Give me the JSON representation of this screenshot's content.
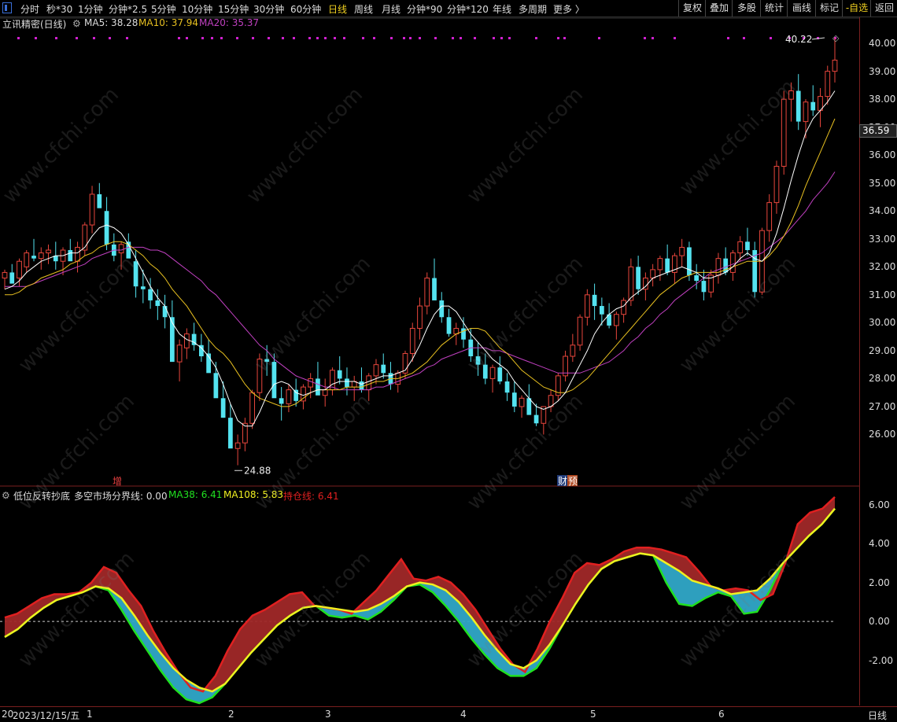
{
  "toolbar": {
    "periods": [
      "分时",
      "秒*30",
      "1分钟",
      "分钟*2.5",
      "5分钟",
      "10分钟",
      "15分钟",
      "30分钟",
      "60分钟",
      "日线",
      "周线",
      "月线",
      "分钟*90",
      "分钟*120",
      "年线",
      "多周期",
      "更多 〉"
    ],
    "active_index": 9,
    "right_buttons": [
      "复权",
      "叠加",
      "多股",
      "统计",
      "画线",
      "标记",
      "-自选",
      "返回"
    ]
  },
  "title": {
    "stock": "立讯精密(日线)",
    "ma5": "MA5: 38.28",
    "ma10": "MA10: 37.94",
    "ma20": "MA20: 35.37"
  },
  "indicator": {
    "name": "低位反转抄底",
    "boundary": "多空市场分界线: 0.00",
    "ma38": "MA38: 6.41",
    "ma108": "MA108: 5.83",
    "hold": "持仓线: 6.41"
  },
  "annotations": {
    "high": "40.22",
    "low": "24.88",
    "current_price": "36.59",
    "event_zeng": "增",
    "event_cai": "财",
    "event_yu": "预"
  },
  "axis": {
    "price_ticks": [
      "40.00",
      "39.00",
      "38.00",
      "37.00",
      "36.00",
      "35.00",
      "34.00",
      "33.00",
      "32.00",
      "31.00",
      "30.00",
      "29.00",
      "28.00",
      "27.00",
      "26.00"
    ],
    "ind_ticks": [
      "6.00",
      "4.00",
      "2.00",
      "0.00",
      "-2.00"
    ],
    "date_label": "2023/12/15/五",
    "date_prefix": "20",
    "months": [
      "1",
      "2",
      "3",
      "4",
      "5",
      "6"
    ],
    "period_label": "日线"
  },
  "watermark": "www.cfchi.com",
  "colors": {
    "up": "#e8463c",
    "down": "#54e3f0",
    "ma5": "#ffffff",
    "ma10": "#e8c020",
    "ma20": "#c040c0",
    "ind_red": "#e02020",
    "ind_yellow": "#f0f020",
    "ind_green": "#20e020",
    "ind_fill_red": "#a02828",
    "ind_fill_cyan": "#30a8c8"
  },
  "chart_data": {
    "type": "candlestick",
    "y_range": [
      25.0,
      40.2
    ],
    "candles": [
      [
        31.6,
        31.9,
        31.2,
        31.8
      ],
      [
        31.8,
        32.1,
        31.5,
        31.4
      ],
      [
        31.6,
        32.3,
        31.3,
        32.2
      ],
      [
        32.0,
        32.6,
        31.8,
        32.5
      ],
      [
        32.4,
        33.0,
        32.2,
        32.3
      ],
      [
        32.3,
        32.7,
        31.9,
        32.5
      ],
      [
        32.5,
        32.8,
        32.1,
        32.6
      ],
      [
        32.4,
        32.9,
        31.9,
        32.2
      ],
      [
        32.2,
        32.7,
        31.7,
        32.6
      ],
      [
        32.6,
        33.0,
        32.3,
        32.2
      ],
      [
        32.2,
        32.9,
        31.8,
        32.7
      ],
      [
        32.6,
        33.6,
        32.4,
        33.5
      ],
      [
        33.5,
        34.9,
        33.2,
        34.6
      ],
      [
        34.6,
        35.0,
        34.2,
        34.1
      ],
      [
        34.0,
        34.5,
        32.6,
        32.8
      ],
      [
        32.8,
        33.2,
        32.2,
        32.4
      ],
      [
        32.5,
        32.9,
        31.9,
        32.8
      ],
      [
        32.9,
        33.2,
        32.5,
        32.3
      ],
      [
        32.2,
        32.6,
        30.9,
        31.3
      ],
      [
        31.3,
        31.9,
        30.7,
        31.2
      ],
      [
        31.2,
        31.6,
        30.5,
        30.8
      ],
      [
        30.8,
        31.2,
        30.1,
        30.6
      ],
      [
        30.6,
        31.0,
        29.8,
        30.2
      ],
      [
        30.2,
        30.8,
        29.2,
        28.6
      ],
      [
        28.6,
        29.4,
        27.9,
        29.2
      ],
      [
        29.1,
        29.8,
        28.7,
        29.6
      ],
      [
        29.6,
        30.0,
        29.0,
        29.2
      ],
      [
        29.2,
        29.6,
        28.6,
        28.8
      ],
      [
        28.9,
        29.4,
        28.3,
        28.2
      ],
      [
        28.2,
        28.6,
        27.4,
        27.3
      ],
      [
        27.3,
        27.9,
        26.6,
        26.6
      ],
      [
        26.6,
        27.1,
        25.6,
        25.5
      ],
      [
        25.5,
        26.0,
        24.9,
        25.7
      ],
      [
        25.7,
        26.6,
        25.4,
        26.4
      ],
      [
        26.4,
        27.6,
        26.2,
        27.5
      ],
      [
        27.5,
        28.9,
        27.2,
        28.7
      ],
      [
        28.7,
        29.2,
        28.1,
        28.6
      ],
      [
        28.6,
        28.9,
        27.9,
        27.3
      ],
      [
        27.3,
        27.7,
        26.5,
        27.1
      ],
      [
        27.1,
        27.8,
        26.8,
        27.6
      ],
      [
        27.6,
        28.0,
        27.0,
        27.2
      ],
      [
        27.2,
        27.8,
        26.9,
        27.7
      ],
      [
        27.7,
        28.2,
        27.3,
        28.0
      ],
      [
        28.0,
        28.6,
        27.5,
        27.4
      ],
      [
        27.4,
        28.0,
        27.0,
        27.6
      ],
      [
        27.6,
        28.4,
        27.4,
        28.3
      ],
      [
        28.3,
        28.8,
        27.8,
        28.0
      ],
      [
        28.0,
        28.4,
        27.4,
        27.7
      ],
      [
        27.7,
        28.1,
        27.2,
        27.9
      ],
      [
        27.9,
        28.4,
        27.5,
        27.6
      ],
      [
        27.6,
        28.2,
        27.2,
        28.1
      ],
      [
        28.1,
        28.7,
        27.8,
        28.5
      ],
      [
        28.5,
        28.9,
        28.0,
        28.2
      ],
      [
        28.2,
        28.6,
        27.6,
        27.8
      ],
      [
        27.8,
        28.3,
        27.5,
        28.2
      ],
      [
        28.2,
        29.0,
        28.0,
        28.9
      ],
      [
        28.9,
        30.0,
        28.6,
        29.8
      ],
      [
        29.8,
        30.9,
        29.4,
        30.6
      ],
      [
        30.6,
        31.8,
        30.3,
        31.6
      ],
      [
        31.6,
        32.3,
        31.0,
        30.8
      ],
      [
        30.8,
        31.1,
        30.0,
        30.2
      ],
      [
        30.2,
        30.5,
        29.5,
        29.6
      ],
      [
        29.6,
        30.0,
        29.2,
        29.8
      ],
      [
        29.8,
        30.2,
        29.1,
        29.4
      ],
      [
        29.4,
        29.8,
        28.6,
        28.8
      ],
      [
        28.8,
        29.3,
        28.1,
        28.5
      ],
      [
        28.5,
        28.9,
        27.8,
        28.0
      ],
      [
        28.0,
        28.5,
        27.5,
        28.4
      ],
      [
        28.4,
        28.8,
        27.8,
        27.9
      ],
      [
        27.9,
        28.2,
        27.2,
        27.5
      ],
      [
        27.5,
        27.9,
        26.8,
        27.0
      ],
      [
        27.0,
        27.4,
        26.6,
        27.3
      ],
      [
        27.3,
        27.8,
        27.0,
        26.7
      ],
      [
        26.7,
        27.1,
        26.3,
        26.4
      ],
      [
        26.4,
        26.8,
        26.0,
        27.0
      ],
      [
        27.0,
        27.6,
        26.8,
        27.4
      ],
      [
        27.4,
        28.2,
        27.2,
        28.1
      ],
      [
        28.1,
        29.0,
        27.9,
        28.8
      ],
      [
        28.8,
        29.6,
        28.6,
        29.2
      ],
      [
        29.2,
        30.3,
        29.0,
        30.2
      ],
      [
        30.2,
        31.2,
        29.9,
        31.0
      ],
      [
        31.0,
        31.4,
        30.1,
        30.6
      ],
      [
        30.6,
        30.9,
        29.9,
        30.3
      ],
      [
        30.3,
        30.7,
        29.8,
        29.9
      ],
      [
        29.9,
        30.4,
        29.4,
        30.3
      ],
      [
        30.3,
        30.9,
        30.0,
        30.8
      ],
      [
        30.8,
        32.3,
        30.6,
        32.0
      ],
      [
        32.0,
        32.4,
        31.0,
        31.2
      ],
      [
        31.2,
        31.8,
        30.8,
        31.6
      ],
      [
        31.6,
        32.1,
        31.3,
        31.9
      ],
      [
        31.9,
        32.4,
        31.5,
        32.3
      ],
      [
        32.3,
        32.8,
        31.7,
        31.8
      ],
      [
        31.8,
        32.5,
        31.4,
        32.4
      ],
      [
        32.4,
        33.0,
        32.0,
        32.7
      ],
      [
        32.7,
        32.9,
        31.5,
        31.7
      ],
      [
        31.7,
        32.1,
        31.2,
        31.5
      ],
      [
        31.5,
        31.9,
        30.8,
        31.1
      ],
      [
        31.1,
        31.9,
        30.9,
        31.7
      ],
      [
        31.7,
        32.5,
        31.4,
        32.3
      ],
      [
        32.3,
        32.7,
        31.7,
        31.8
      ],
      [
        31.8,
        32.6,
        31.5,
        32.5
      ],
      [
        32.5,
        33.1,
        32.2,
        32.9
      ],
      [
        32.9,
        33.4,
        32.4,
        32.6
      ],
      [
        32.6,
        32.9,
        30.9,
        31.1
      ],
      [
        31.1,
        33.4,
        31.0,
        33.3
      ],
      [
        33.3,
        34.6,
        32.9,
        34.3
      ],
      [
        34.3,
        35.8,
        33.9,
        35.6
      ],
      [
        35.6,
        38.3,
        35.3,
        38.0
      ],
      [
        38.0,
        38.6,
        37.2,
        38.3
      ],
      [
        38.3,
        38.9,
        36.9,
        37.2
      ],
      [
        37.2,
        38.0,
        36.6,
        37.9
      ],
      [
        37.9,
        38.5,
        37.4,
        37.6
      ],
      [
        37.6,
        38.4,
        37.0,
        38.1
      ],
      [
        38.1,
        39.2,
        37.8,
        39.0
      ],
      [
        39.0,
        40.2,
        38.6,
        39.4
      ]
    ],
    "ma5": [
      31.2,
      31.3,
      31.5,
      31.8,
      32.0,
      32.2,
      32.3,
      32.4,
      32.4,
      32.5,
      32.5,
      32.7,
      33.1,
      33.4,
      33.5,
      33.4,
      33.2,
      32.8,
      32.3,
      31.8,
      31.3,
      30.9,
      30.6,
      30.0,
      29.6,
      29.4,
      29.3,
      29.1,
      28.8,
      28.4,
      27.8,
      27.1,
      26.5,
      26.3,
      26.3,
      26.8,
      27.4,
      27.8,
      27.9,
      27.8,
      27.5,
      27.4,
      27.5,
      27.6,
      27.6,
      27.8,
      27.9,
      27.9,
      27.9,
      27.8,
      27.9,
      28.0,
      28.1,
      28.1,
      28.2,
      28.3,
      28.7,
      29.2,
      29.8,
      30.3,
      30.6,
      30.6,
      30.4,
      30.0,
      29.6,
      29.3,
      29.0,
      28.7,
      28.5,
      28.3,
      27.9,
      27.6,
      27.3,
      27.0,
      26.9,
      27.0,
      27.2,
      27.5,
      28.0,
      28.5,
      29.0,
      29.6,
      30.0,
      30.3,
      30.5,
      30.6,
      30.9,
      31.1,
      31.3,
      31.6,
      31.7,
      31.8,
      31.9,
      32.0,
      31.9,
      31.8,
      31.6,
      31.6,
      31.7,
      31.8,
      32.0,
      32.3,
      32.5,
      32.3,
      32.2,
      32.5,
      33.2,
      34.1,
      35.1,
      36.0,
      36.8,
      37.3,
      37.6,
      37.9,
      38.3
    ],
    "ma10": [
      31.0,
      31.0,
      31.1,
      31.3,
      31.4,
      31.6,
      31.7,
      31.8,
      31.9,
      32.1,
      32.2,
      32.4,
      32.5,
      32.7,
      32.8,
      32.9,
      32.9,
      32.8,
      32.6,
      32.4,
      32.1,
      31.9,
      31.6,
      31.2,
      30.9,
      30.6,
      30.2,
      29.8,
      29.4,
      29.1,
      28.9,
      28.6,
      28.2,
      27.8,
      27.5,
      27.3,
      27.2,
      27.1,
      27.0,
      27.0,
      27.1,
      27.3,
      27.5,
      27.6,
      27.6,
      27.6,
      27.6,
      27.7,
      27.7,
      27.7,
      27.8,
      27.9,
      27.9,
      28.0,
      28.0,
      28.1,
      28.2,
      28.4,
      28.6,
      28.9,
      29.2,
      29.4,
      29.6,
      29.7,
      29.8,
      29.8,
      29.7,
      29.4,
      29.1,
      28.9,
      28.6,
      28.3,
      28.1,
      27.9,
      27.7,
      27.6,
      27.5,
      27.5,
      27.6,
      27.8,
      28.0,
      28.3,
      28.6,
      28.9,
      29.2,
      29.5,
      29.8,
      30.1,
      30.4,
      30.7,
      31.0,
      31.2,
      31.4,
      31.6,
      31.7,
      31.8,
      31.8,
      31.8,
      31.8,
      31.9,
      32.0,
      32.1,
      32.2,
      32.2,
      32.2,
      32.4,
      32.7,
      33.1,
      33.6,
      34.2,
      34.9,
      35.5,
      36.1,
      36.7,
      37.3
    ],
    "ma20": [
      31.3,
      31.3,
      31.3,
      31.3,
      31.4,
      31.5,
      31.6,
      31.7,
      31.8,
      31.9,
      32.0,
      32.1,
      32.3,
      32.4,
      32.5,
      32.6,
      32.6,
      32.7,
      32.7,
      32.7,
      32.6,
      32.6,
      32.5,
      32.3,
      32.1,
      31.9,
      31.7,
      31.5,
      31.2,
      31.0,
      30.7,
      30.4,
      30.1,
      29.8,
      29.5,
      29.2,
      29.0,
      28.7,
      28.5,
      28.3,
      28.1,
      28.0,
      27.9,
      27.8,
      27.7,
      27.7,
      27.6,
      27.6,
      27.6,
      27.6,
      27.6,
      27.7,
      27.7,
      27.8,
      27.9,
      28.0,
      28.1,
      28.2,
      28.4,
      28.5,
      28.7,
      28.8,
      28.9,
      29.0,
      29.1,
      29.1,
      29.1,
      29.0,
      29.0,
      28.9,
      28.8,
      28.7,
      28.6,
      28.5,
      28.4,
      28.3,
      28.2,
      28.2,
      28.2,
      28.2,
      28.3,
      28.4,
      28.5,
      28.6,
      28.8,
      29.0,
      29.3,
      29.5,
      29.8,
      30.0,
      30.3,
      30.5,
      30.8,
      31.0,
      31.2,
      31.4,
      31.6,
      31.8,
      31.9,
      32.0,
      32.1,
      32.2,
      32.3,
      32.4,
      32.5,
      32.7,
      32.9,
      33.1,
      33.4,
      33.7,
      34.0,
      34.4,
      34.7,
      35.0,
      35.4
    ],
    "ind_range": [
      -4.2,
      6.8
    ],
    "ind_red": [
      0.2,
      0.4,
      0.8,
      1.2,
      1.4,
      1.4,
      1.5,
      2.0,
      2.8,
      2.5,
      1.6,
      0.8,
      -0.5,
      -1.6,
      -2.6,
      -3.4,
      -3.6,
      -2.8,
      -1.5,
      -0.4,
      0.3,
      0.6,
      1.0,
      1.4,
      1.5,
      0.8,
      0.7,
      0.6,
      0.4,
      1.0,
      1.6,
      2.4,
      3.2,
      2.2,
      2.1,
      2.3,
      2.0,
      1.4,
      0.6,
      -0.4,
      -1.4,
      -2.2,
      -2.6,
      -1.4,
      0.0,
      1.2,
      2.5,
      3.0,
      2.9,
      3.2,
      3.6,
      3.8,
      3.8,
      3.7,
      3.5,
      3.3,
      2.6,
      1.8,
      1.6,
      1.7,
      1.6,
      1.1,
      1.4,
      3.0,
      5.0,
      5.6,
      5.8,
      6.4
    ],
    "ind_yellow": [
      -0.8,
      -0.4,
      0.2,
      0.7,
      1.1,
      1.3,
      1.5,
      1.8,
      1.7,
      1.2,
      0.3,
      -0.7,
      -1.6,
      -2.4,
      -3.0,
      -3.4,
      -3.6,
      -3.2,
      -2.4,
      -1.6,
      -0.9,
      -0.2,
      0.3,
      0.7,
      0.8,
      0.7,
      0.6,
      0.5,
      0.6,
      0.9,
      1.3,
      1.8,
      2.0,
      1.9,
      1.6,
      1.0,
      0.2,
      -0.7,
      -1.5,
      -2.2,
      -2.4,
      -2.0,
      -1.2,
      -0.2,
      0.9,
      1.9,
      2.7,
      3.1,
      3.3,
      3.5,
      3.4,
      3.0,
      2.6,
      2.1,
      1.9,
      1.7,
      1.4,
      1.5,
      1.6,
      2.2,
      3.0,
      3.7,
      4.4,
      5.0,
      5.8
    ],
    "ind_green": [
      -0.8,
      -0.4,
      0.2,
      0.7,
      1.1,
      1.3,
      1.5,
      1.8,
      1.6,
      0.6,
      -0.5,
      -1.5,
      -2.5,
      -3.4,
      -4.0,
      -4.2,
      -3.9,
      -3.2,
      -2.4,
      -1.6,
      -0.9,
      -0.2,
      0.3,
      0.7,
      0.8,
      0.3,
      0.2,
      0.3,
      0.1,
      0.5,
      1.1,
      1.8,
      1.9,
      1.5,
      0.8,
      0.0,
      -0.9,
      -1.7,
      -2.4,
      -2.8,
      -2.8,
      -2.4,
      -1.4,
      -0.2,
      0.9,
      1.9,
      2.7,
      3.1,
      3.3,
      3.5,
      3.4,
      2.0,
      0.9,
      0.8,
      1.2,
      1.5,
      1.3,
      0.4,
      0.5,
      1.6,
      3.0,
      3.7,
      4.4,
      5.0,
      5.8
    ]
  }
}
